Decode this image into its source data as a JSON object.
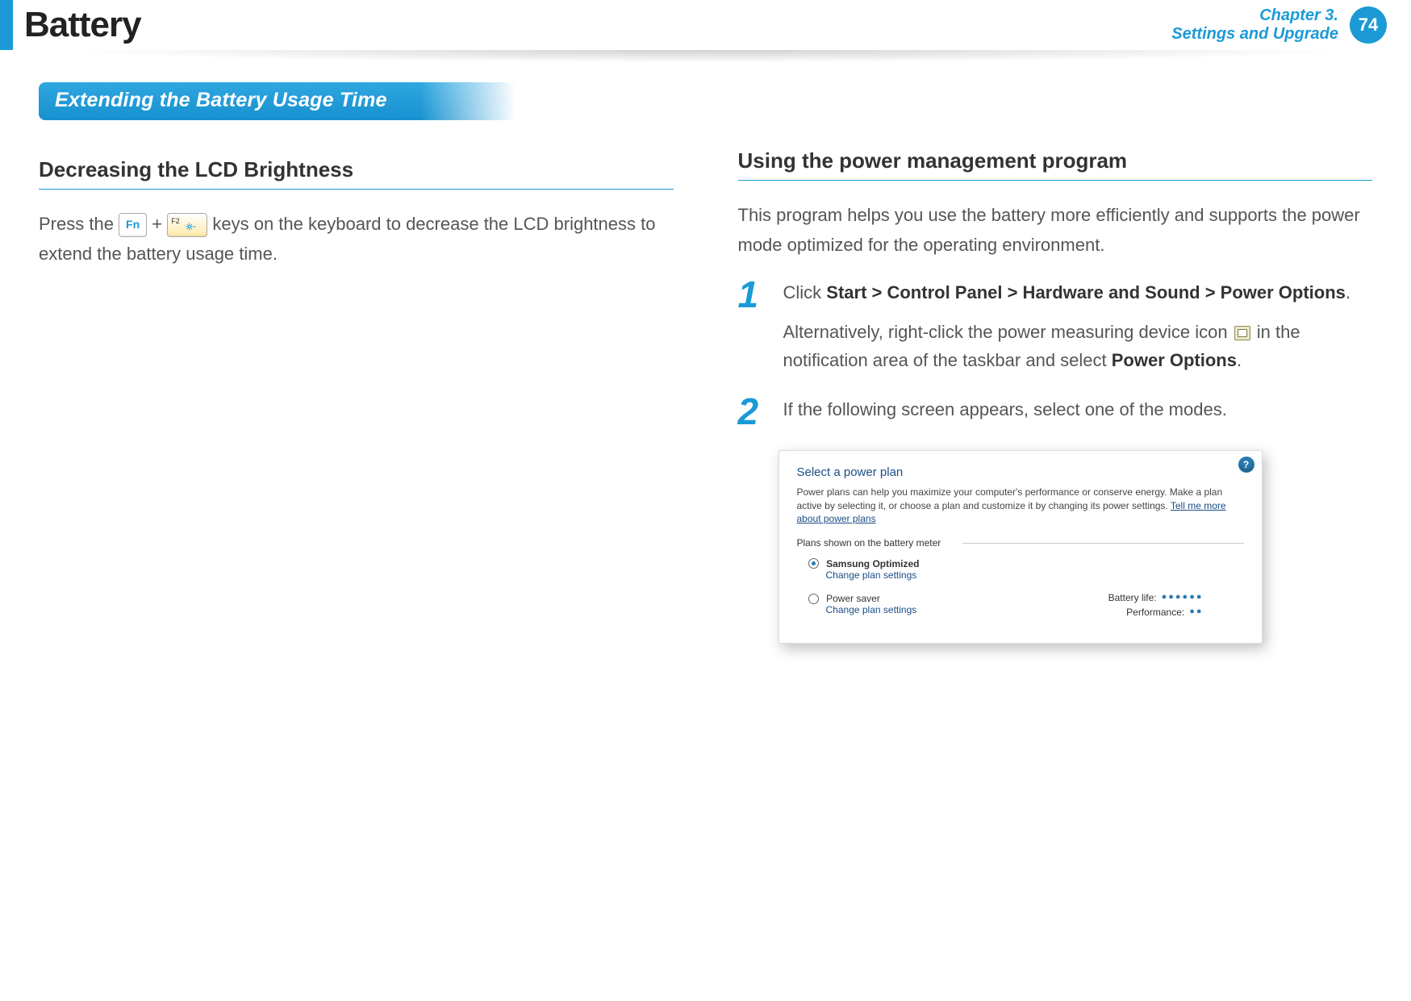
{
  "header": {
    "title": "Battery",
    "chapter_line1": "Chapter 3.",
    "chapter_line2": "Settings and Upgrade",
    "page_number": "74"
  },
  "section_bar": "Extending the Battery Usage Time",
  "left": {
    "subheading": "Decreasing the LCD Brightness",
    "para_pre": "Press the ",
    "key_fn": "Fn",
    "plus": " + ",
    "key_f2_label": "F2",
    "para_post": " keys on the keyboard to decrease the LCD brightness to extend the battery usage time."
  },
  "right": {
    "subheading": "Using the power management program",
    "intro": "This program helps you use the battery more efficiently and supports the power mode optimized for the operating environment.",
    "steps": [
      {
        "num": "1",
        "line1_pre": "Click ",
        "line1_bold": "Start > Control Panel > Hardware and Sound > Power Options",
        "line1_post": ".",
        "line2_pre": "Alternatively, right-click the power measuring device icon ",
        "line2_mid": " in the notification area of the taskbar and select ",
        "line2_bold": "Power Options",
        "line2_post": "."
      },
      {
        "num": "2",
        "text": "If the following screen appears, select one of the modes."
      }
    ]
  },
  "power_panel": {
    "title": "Select a power plan",
    "desc_pre": "Power plans can help you maximize your computer's performance or conserve energy. Make a plan active by selecting it, or choose a plan and customize it by changing its power settings. ",
    "desc_link": "Tell me more about power plans",
    "group_label": "Plans shown on the battery meter",
    "plan1": {
      "name": "Samsung Optimized",
      "change": "Change plan settings",
      "selected": true
    },
    "plan2": {
      "name": "Power saver",
      "change": "Change plan settings",
      "selected": false,
      "battery_label": "Battery life:",
      "battery_dots": "●●●●●●",
      "perf_label": "Performance:",
      "perf_dots": "●●"
    },
    "help": "?"
  }
}
